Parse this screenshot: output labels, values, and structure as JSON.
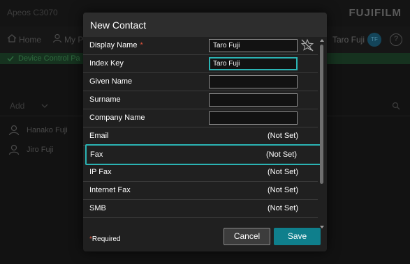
{
  "background": {
    "app_title": "Apeos C3070",
    "brand": "FUJIFILM",
    "nav": {
      "home": "Home",
      "my": "My P"
    },
    "user": {
      "name": "Taro Fuji",
      "initials": "TF"
    },
    "help": "?",
    "status_text": "Device Control Pa",
    "add_label": "Add",
    "contacts": [
      "Hanako Fuji",
      "Jiro Fuji"
    ]
  },
  "dialog": {
    "title": "New Contact",
    "required_marker": "*",
    "fields": [
      {
        "label": "Display Name",
        "required": true,
        "type": "input",
        "value": "Taro Fuji"
      },
      {
        "label": "Index Key",
        "type": "input",
        "value": "Taro Fuji",
        "focused": true
      },
      {
        "label": "Given Name",
        "type": "input",
        "value": ""
      },
      {
        "label": "Surname",
        "type": "input",
        "value": ""
      },
      {
        "label": "Company Name",
        "type": "input",
        "value": ""
      },
      {
        "label": "Email",
        "type": "status",
        "value": "(Not Set)"
      },
      {
        "label": "Fax",
        "type": "status",
        "value": "(Not Set)",
        "highlighted": true
      },
      {
        "label": "IP Fax",
        "type": "status",
        "value": "(Not Set)"
      },
      {
        "label": "Internet Fax",
        "type": "status",
        "value": "(Not Set)"
      },
      {
        "label": "SMB",
        "type": "status",
        "value": "(Not Set)"
      }
    ],
    "footer": {
      "required_star": "*",
      "required_note": "Required",
      "cancel_label": "Cancel",
      "save_label": "Save"
    }
  },
  "colors": {
    "accent_teal": "#2bb3b3",
    "save_button": "#0f7f8c",
    "required_red": "#e0533b"
  },
  "icons": {
    "clear_display_name": "star-clear-icon",
    "scroll": "scrollbar"
  }
}
